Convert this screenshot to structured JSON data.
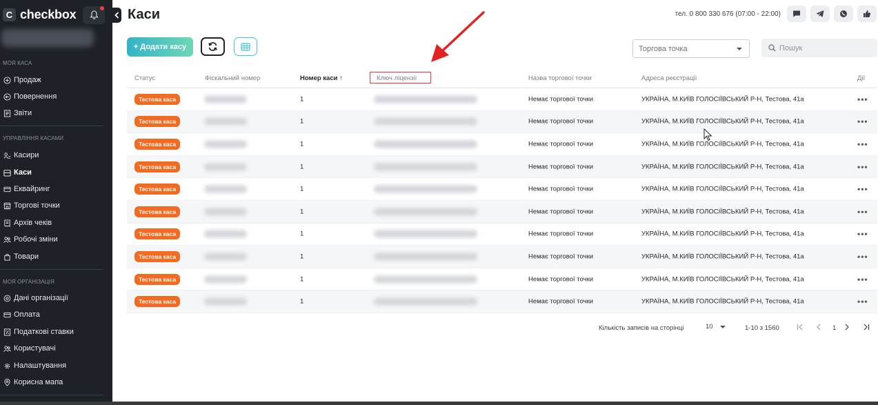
{
  "app": {
    "logo_mark": "C",
    "logo_text": "checkbox"
  },
  "sidebar": {
    "section1": "МОЯ КАСА",
    "items1": [
      {
        "label": "Продаж",
        "icon": "plus-circle-icon"
      },
      {
        "label": "Повернення",
        "icon": "undo-circle-icon"
      },
      {
        "label": "Звіти",
        "icon": "report-icon"
      }
    ],
    "section2": "УПРАВЛІННЯ КАСАМИ",
    "items2": [
      {
        "label": "Касири",
        "icon": "cashier-icon"
      },
      {
        "label": "Каси",
        "icon": "register-icon"
      },
      {
        "label": "Еквайринг",
        "icon": "card-icon"
      },
      {
        "label": "Торгові точки",
        "icon": "store-icon"
      },
      {
        "label": "Архів чеків",
        "icon": "receipt-icon"
      },
      {
        "label": "Робочі зміни",
        "icon": "users-icon"
      },
      {
        "label": "Товари",
        "icon": "bag-icon"
      }
    ],
    "section3": "МОЯ ОРГАНІЗАЦІЯ",
    "items3": [
      {
        "label": "Дані організації",
        "icon": "settings-icon"
      },
      {
        "label": "Оплата",
        "icon": "card-icon"
      },
      {
        "label": "Податкові ставки",
        "icon": "tax-icon"
      },
      {
        "label": "Користувачі",
        "icon": "users-icon"
      },
      {
        "label": "Налаштування",
        "icon": "gear-icon"
      },
      {
        "label": "Корисна мапа",
        "icon": "map-pin-icon"
      }
    ]
  },
  "header": {
    "title": "Каси",
    "phone": "тел. 0 800 330 676 (07:00 - 22:00)"
  },
  "toolbar": {
    "add_label": "+ Додати касу",
    "store_select": "Торгова точка",
    "search_placeholder": "Пошук"
  },
  "table": {
    "columns": [
      "Статус",
      "Фіскальний номер",
      "Номер каси ↑",
      "Ключ ліцензії",
      "Назва торгової точки",
      "Адреса реєстрації",
      "Дії"
    ],
    "rows": [
      {
        "status": "Тестова каса",
        "number": "1",
        "store": "Немає торгової точки",
        "address": "УКРАЇНА, М.КИЇВ ГОЛОСІЇВСЬКИЙ Р-Н, Тестова, 41а",
        "actions": "•••"
      },
      {
        "status": "Тестова каса",
        "number": "1",
        "store": "Немає торгової точки",
        "address": "УКРАЇНА, М.КИЇВ ГОЛОСІЇВСЬКИЙ Р-Н, Тестова, 41а",
        "actions": "•••"
      },
      {
        "status": "Тестова каса",
        "number": "1",
        "store": "Немає торгової точки",
        "address": "УКРАЇНА, М.КИЇВ ГОЛОСІЇВСЬКИЙ Р-Н, Тестова, 41а",
        "actions": "•••"
      },
      {
        "status": "Тестова каса",
        "number": "1",
        "store": "Немає торгової точки",
        "address": "УКРАЇНА, М.КИЇВ ГОЛОСІЇВСЬКИЙ Р-Н, Тестова, 41а",
        "actions": "•••"
      },
      {
        "status": "Тестова каса",
        "number": "1",
        "store": "Немає торгової точки",
        "address": "УКРАЇНА, М.КИЇВ ГОЛОСІЇВСЬКИЙ Р-Н, Тестова, 41а",
        "actions": "•••"
      },
      {
        "status": "Тестова каса",
        "number": "1",
        "store": "Немає торгової точки",
        "address": "УКРАЇНА, М.КИЇВ ГОЛОСІЇВСЬКИЙ Р-Н, Тестова, 41а",
        "actions": "•••"
      },
      {
        "status": "Тестова каса",
        "number": "1",
        "store": "Немає торгової точки",
        "address": "УКРАЇНА, М.КИЇВ ГОЛОСІЇВСЬКИЙ Р-Н, Тестова, 41а",
        "actions": "•••"
      },
      {
        "status": "Тестова каса",
        "number": "1",
        "store": "Немає торгової точки",
        "address": "УКРАЇНА, М.КИЇВ ГОЛОСІЇВСЬКИЙ Р-Н, Тестова, 41а",
        "actions": "•••"
      },
      {
        "status": "Тестова каса",
        "number": "1",
        "store": "Немає торгової точки",
        "address": "УКРАЇНА, М.КИЇВ ГОЛОСІЇВСЬКИЙ Р-Н, Тестова, 41а",
        "actions": "•••"
      },
      {
        "status": "Тестова каса",
        "number": "1",
        "store": "Немає торгової точки",
        "address": "УКРАЇНА, М.КИЇВ ГОЛОСІЇВСЬКИЙ Р-Н, Тестова, 41а",
        "actions": "•••"
      }
    ]
  },
  "pagination": {
    "per_page_label": "Кількість записів на сторінці",
    "per_page": "10",
    "range": "1-10 з 1560",
    "current_page": "1"
  },
  "colors": {
    "sidebar_bg": "#1e2127",
    "badge": "#f26b21",
    "annotation_red": "#e03a3a",
    "add_button_gradient": [
      "#34b3c7",
      "#6fd7b6"
    ]
  }
}
